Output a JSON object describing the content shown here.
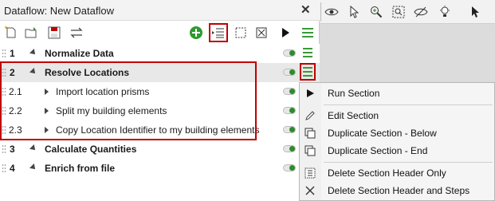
{
  "window": {
    "title": "Dataflow: New Dataflow",
    "close_icon": "close-icon"
  },
  "toolbar": {
    "icons": [
      "new-icon",
      "open-icon",
      "save-icon",
      "swap-icon",
      "add-icon",
      "insert-section-icon",
      "select-box-icon",
      "deselect-box-icon",
      "run-icon",
      "menu-icon"
    ]
  },
  "sections": [
    {
      "number": "1",
      "label": "Normalize Data",
      "expanded": false
    },
    {
      "number": "2",
      "label": "Resolve Locations",
      "expanded": true,
      "steps": [
        {
          "number": "2.1",
          "label": "Import location prisms"
        },
        {
          "number": "2.2",
          "label": "Split my building elements"
        },
        {
          "number": "2.3",
          "label": "Copy Location Identifier to my building elements"
        }
      ]
    },
    {
      "number": "3",
      "label": "Calculate Quantities",
      "expanded": false
    },
    {
      "number": "4",
      "label": "Enrich from file",
      "expanded": false
    }
  ],
  "right_toolbar": {
    "icons": [
      "eye-icon",
      "pointer-icon",
      "zoom-icon",
      "zoom-box-icon",
      "hide-icon",
      "bulb-icon",
      "cursor-icon"
    ]
  },
  "context_menu": {
    "items": [
      {
        "label": "Run Section",
        "icon": "run-icon"
      },
      {
        "label": "Edit Section",
        "icon": "pencil-icon"
      },
      {
        "label": "Duplicate Section - Below",
        "icon": "duplicate-icon"
      },
      {
        "label": "Duplicate Section - End",
        "icon": "duplicate-icon"
      },
      {
        "label": "Delete Section Header Only",
        "icon": "delete-header-icon"
      },
      {
        "label": "Delete Section Header and Steps",
        "icon": "delete-icon"
      }
    ]
  },
  "colors": {
    "accent_green": "#3a9a3a",
    "highlight_red": "#c00000",
    "selected_row": "#e8e8e8"
  }
}
